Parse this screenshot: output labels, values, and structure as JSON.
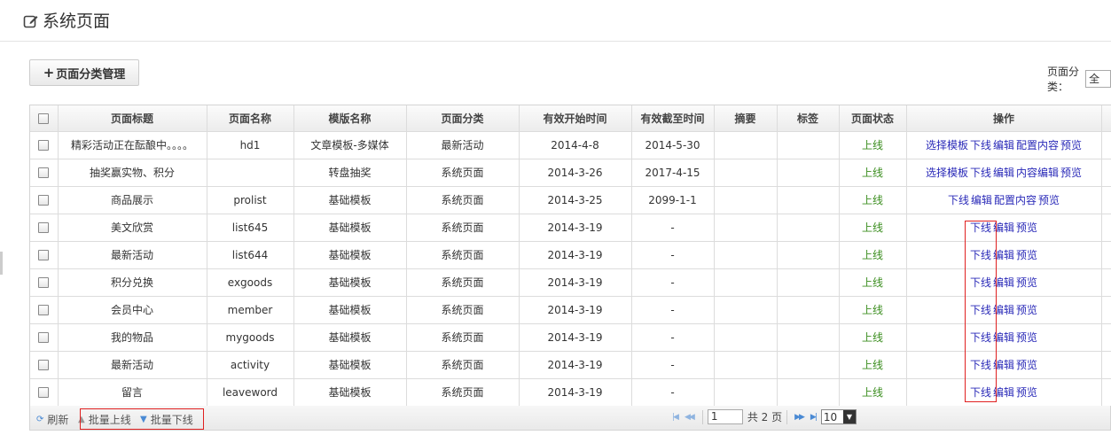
{
  "header": {
    "title": "系统页面",
    "icon": "edit-icon"
  },
  "category_button": {
    "label": "页面分类管理",
    "icon": "plus-icon"
  },
  "filter": {
    "label": "页面分类：",
    "value": "全"
  },
  "table": {
    "columns": [
      "页面标题",
      "页面名称",
      "模版名称",
      "页面分类",
      "有效开始时间",
      "有效截至时间",
      "摘要",
      "标签",
      "页面状态",
      "操作"
    ],
    "rows": [
      {
        "title": "精彩活动正在酝酿中。。。。",
        "name": "hd1",
        "template": "文章模板-多媒体",
        "category": "最新活动",
        "start": "2014-4-8",
        "end": "2014-5-30",
        "summary": "",
        "tags": "",
        "status": "上线",
        "ops": [
          "选择模板",
          "下线",
          "编辑",
          "配置内容",
          "预览"
        ]
      },
      {
        "title": "抽奖赢实物、积分",
        "name": "",
        "template": "转盘抽奖",
        "category": "系统页面",
        "start": "2014-3-26",
        "end": "2017-4-15",
        "summary": "",
        "tags": "",
        "status": "上线",
        "ops": [
          "选择模板",
          "下线",
          "编辑",
          "内容编辑",
          "预览"
        ]
      },
      {
        "title": "商品展示",
        "name": "prolist",
        "template": "基础模板",
        "category": "系统页面",
        "start": "2014-3-25",
        "end": "2099-1-1",
        "summary": "",
        "tags": "",
        "status": "上线",
        "ops": [
          "下线",
          "编辑",
          "配置内容",
          "预览"
        ]
      },
      {
        "title": "美文欣赏",
        "name": "list645",
        "template": "基础模板",
        "category": "系统页面",
        "start": "2014-3-19",
        "end": "-",
        "summary": "",
        "tags": "",
        "status": "上线",
        "ops": [
          "下线",
          "编辑",
          "预览"
        ]
      },
      {
        "title": "最新活动",
        "name": "list644",
        "template": "基础模板",
        "category": "系统页面",
        "start": "2014-3-19",
        "end": "-",
        "summary": "",
        "tags": "",
        "status": "上线",
        "ops": [
          "下线",
          "编辑",
          "预览"
        ]
      },
      {
        "title": "积分兑换",
        "name": "exgoods",
        "template": "基础模板",
        "category": "系统页面",
        "start": "2014-3-19",
        "end": "-",
        "summary": "",
        "tags": "",
        "status": "上线",
        "ops": [
          "下线",
          "编辑",
          "预览"
        ]
      },
      {
        "title": "会员中心",
        "name": "member",
        "template": "基础模板",
        "category": "系统页面",
        "start": "2014-3-19",
        "end": "-",
        "summary": "",
        "tags": "",
        "status": "上线",
        "ops": [
          "下线",
          "编辑",
          "预览"
        ]
      },
      {
        "title": "我的物品",
        "name": "mygoods",
        "template": "基础模板",
        "category": "系统页面",
        "start": "2014-3-19",
        "end": "-",
        "summary": "",
        "tags": "",
        "status": "上线",
        "ops": [
          "下线",
          "编辑",
          "预览"
        ]
      },
      {
        "title": "最新活动",
        "name": "activity",
        "template": "基础模板",
        "category": "系统页面",
        "start": "2014-3-19",
        "end": "-",
        "summary": "",
        "tags": "",
        "status": "上线",
        "ops": [
          "下线",
          "编辑",
          "预览"
        ]
      },
      {
        "title": "留言",
        "name": "leaveword",
        "template": "基础模板",
        "category": "系统页面",
        "start": "2014-3-19",
        "end": "-",
        "summary": "",
        "tags": "",
        "status": "上线",
        "ops": [
          "下线",
          "编辑",
          "预览"
        ]
      }
    ]
  },
  "toolbar": {
    "refresh": "刷新",
    "batch_online": "批量上线",
    "batch_offline": "批量下线"
  },
  "pager": {
    "page": "1",
    "total_text": "共 2 页",
    "page_size": "10"
  },
  "colors": {
    "status_online": "#3b8e1f",
    "link": "#2a2ab8",
    "highlight": "#e02020"
  }
}
